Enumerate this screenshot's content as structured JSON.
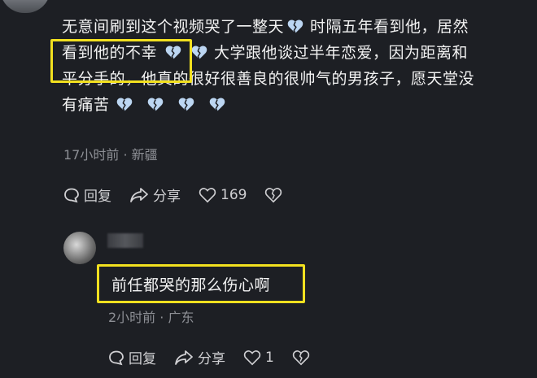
{
  "comment": {
    "line1": "无意间刷到这个视频哭了一整天",
    "line1b": "时隔五年看到他，居然",
    "line2": "看到他的不幸",
    "line2b": "大学跟他谈过半年恋爱，因为距离和",
    "line3": "平分手的，他真的很好很善良的很帅气的男孩子，愿天堂没",
    "line4": "有痛苦",
    "meta": "17小时前 · 新疆",
    "reply_label": "回复",
    "share_label": "分享",
    "like_count": "169"
  },
  "reply": {
    "text": "前任都哭的那么伤心啊",
    "meta": "2小时前 · 广东",
    "reply_label": "回复",
    "share_label": "分享",
    "like_count": "1"
  },
  "colors": {
    "background": "#1d1f24",
    "highlight": "#f2e01f",
    "heart": "#bcd6f2"
  }
}
